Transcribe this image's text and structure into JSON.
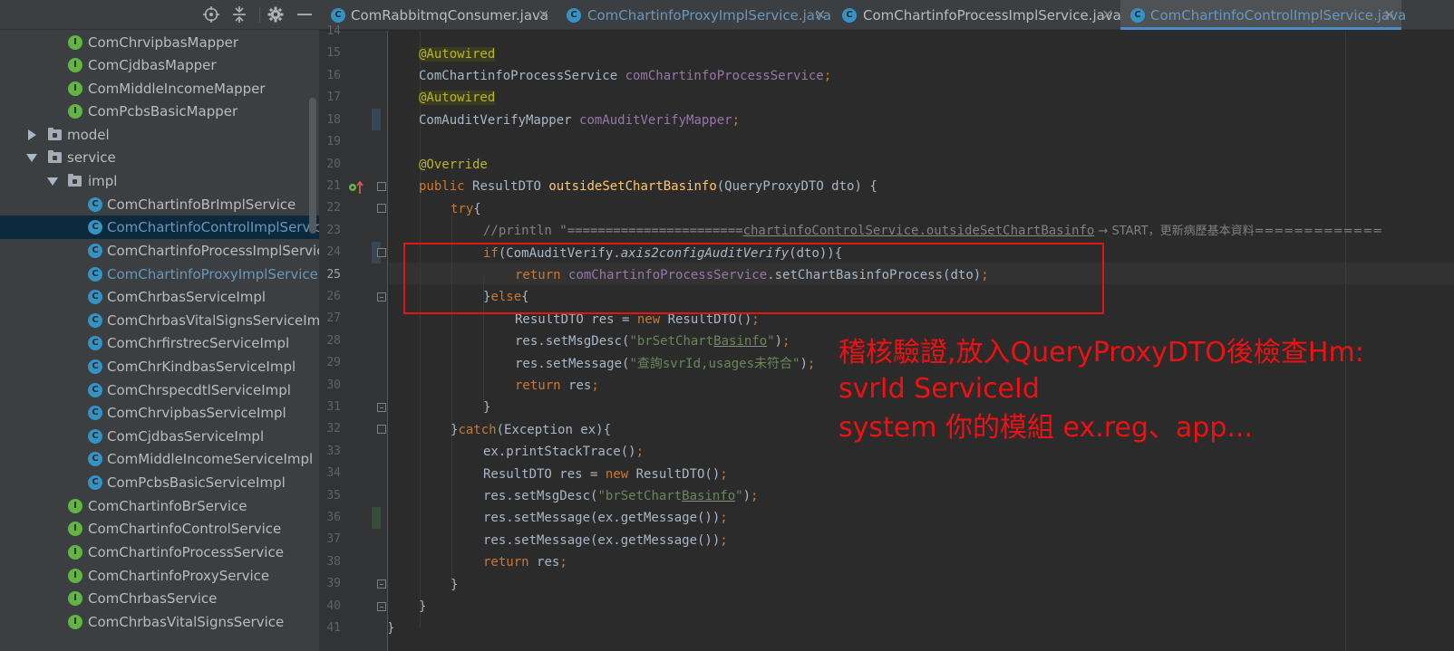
{
  "tree": {
    "rows": [
      {
        "label": "ComChrvipbasMapper",
        "type": "interface"
      },
      {
        "label": "ComCjdbasMapper",
        "type": "interface"
      },
      {
        "label": "ComMiddleIncomeMapper",
        "type": "interface"
      },
      {
        "label": "ComPcbsBasicMapper",
        "type": "interface"
      },
      {
        "label": "model",
        "type": "folder",
        "expanded": false
      },
      {
        "label": "service",
        "type": "folder",
        "expanded": true
      },
      {
        "label": "impl",
        "type": "folder",
        "expanded": true
      },
      {
        "label": "ComChartinfoBrImplService",
        "type": "class"
      },
      {
        "label": "ComChartinfoControlImplService",
        "type": "class",
        "selected": true
      },
      {
        "label": "ComChartinfoProcessImplService",
        "type": "class"
      },
      {
        "label": "ComChartinfoProxyImplService",
        "type": "class",
        "modified": true
      },
      {
        "label": "ComChrbasServiceImpl",
        "type": "class"
      },
      {
        "label": "ComChrbasVitalSignsServiceImpl",
        "type": "class"
      },
      {
        "label": "ComChrfirstrecServiceImpl",
        "type": "class"
      },
      {
        "label": "ComChrKindbasServiceImpl",
        "type": "class"
      },
      {
        "label": "ComChrspecdtlServiceImpl",
        "type": "class"
      },
      {
        "label": "ComChrvipbasServiceImpl",
        "type": "class"
      },
      {
        "label": "ComCjdbasServiceImpl",
        "type": "class"
      },
      {
        "label": "ComMiddleIncomeServiceImpl",
        "type": "class"
      },
      {
        "label": "ComPcbsBasicServiceImpl",
        "type": "class"
      },
      {
        "label": "ComChartinfoBrService",
        "type": "interface"
      },
      {
        "label": "ComChartinfoControlService",
        "type": "interface"
      },
      {
        "label": "ComChartinfoProcessService",
        "type": "interface"
      },
      {
        "label": "ComChartinfoProxyService",
        "type": "interface"
      },
      {
        "label": "ComChrbasService",
        "type": "interface"
      },
      {
        "label": "ComChrbasVitalSignsService",
        "type": "interface"
      }
    ],
    "badges": {
      "interface": "I",
      "class": "C"
    }
  },
  "tabs": [
    {
      "label": "ComRabbitmqConsumer.java",
      "close": "×"
    },
    {
      "label": "ComChartinfoProxyImplService.java",
      "close": "×",
      "modified": true
    },
    {
      "label": "ComChartinfoProcessImplService.java",
      "close": "×"
    },
    {
      "label": "ComChartinfoControlImplService.java",
      "close": "×",
      "active": true,
      "modified": true
    }
  ],
  "gutter": {
    "line_numbers": [
      "14",
      "15",
      "16",
      "17",
      "18",
      "19",
      "20",
      "21",
      "22",
      "23",
      "24",
      "25",
      "26",
      "27",
      "28",
      "29",
      "30",
      "31",
      "32",
      "33",
      "34",
      "35",
      "36",
      "37",
      "38",
      "39",
      "40",
      "41"
    ],
    "current_line": "25"
  },
  "code": {
    "l14": "",
    "l15_ann": "@Autowired",
    "l16_type": "ComChartinfoProcessService ",
    "l16_fld": "comChartinfoProcessService",
    "l16_semi": ";",
    "l17_ann": "@Autowired",
    "l18_type": "ComAuditVerifyMapper ",
    "l18_fld": "comAuditVerifyMapper",
    "l18_semi": ";",
    "l20_ann": "@Override",
    "l21_kw": "public ",
    "l21_type": "ResultDTO ",
    "l21_mth": "outsideSetChartBasinfo",
    "l21_rest": "(QueryProxyDTO dto) {",
    "l22_kw": "try",
    "l22_rest": "{",
    "l23_cmt_a": "//println \"=======================",
    "l23_cmt_b": "chartinfoControlService.outsideSetChart",
    "l23_cmt_c": "Basinfo",
    "l23_cmt_d": " → START，更新病歷基本資料=============",
    "l24_kw": "if",
    "l24_a": "(ComAuditVerify.",
    "l24_ital": "axis2configAuditVerify",
    "l24_b": "(dto)){",
    "l25_kw": "return ",
    "l25_fld": "comChartinfoProcessService",
    "l25_rest": ".setChartBasinfoProcess(dto)",
    "l25_semi": ";",
    "l26_a": "}",
    "l26_kw": "else",
    "l26_b": "{",
    "l27_a": "ResultDTO res = ",
    "l27_kw": "new ",
    "l27_b": "ResultDTO()",
    "l27_semi": ";",
    "l28_a": "res.setMsgDesc(",
    "l28_str_a": "\"brSetChart",
    "l28_str_b": "Basinfo",
    "l28_str_c": "\"",
    "l28_b": ")",
    "l28_semi": ";",
    "l29_a": "res.setMessage(",
    "l29_str": "\"查詢svrId,usages未符合\"",
    "l29_b": ")",
    "l29_semi": ";",
    "l30_kw": "return ",
    "l30_a": "res",
    "l30_semi": ";",
    "l31_a": "}",
    "l32_a": "}",
    "l32_kw": "catch",
    "l32_b": "(Exception ex){",
    "l33_a": "ex.printStackTrace()",
    "l33_semi": ";",
    "l34_a": "ResultDTO res = ",
    "l34_kw": "new ",
    "l34_b": "ResultDTO()",
    "l34_semi": ";",
    "l35_a": "res.setMsgDesc(",
    "l35_str_a": "\"brSetChart",
    "l35_str_b": "Basinfo",
    "l35_str_c": "\"",
    "l35_b": ")",
    "l35_semi": ";",
    "l36_a": "res.setMessage(ex.getMessage())",
    "l36_semi": ";",
    "l37_a": "res.setMessage(ex.getMessage())",
    "l37_semi": ";",
    "l38_kw": "return ",
    "l38_a": "res",
    "l38_semi": ";",
    "l39_a": "}",
    "l40_a": "}",
    "l41_a": "}"
  },
  "annotation": {
    "line1": "稽核驗證,放入QueryProxyDTO後檢查Hm:",
    "line2": "svrId  ServiceId",
    "line3": "system 你的模組 ex.reg、app..."
  },
  "colors": {
    "annotation": "#ee1111",
    "keyword": "#cc7832",
    "annotation_java": "#bbb529",
    "field": "#9876aa",
    "method": "#ffc66d",
    "string": "#6a8759",
    "comment": "#808080"
  }
}
